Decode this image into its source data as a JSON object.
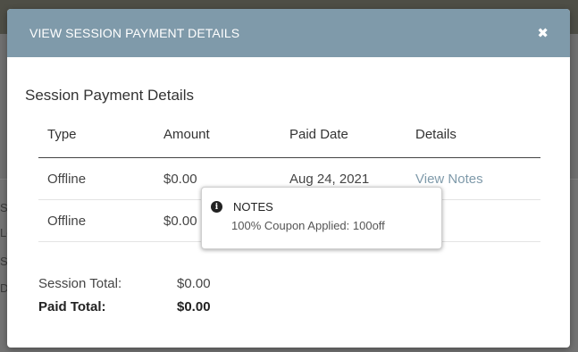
{
  "background": {
    "fragments": [
      "Si",
      "Lo",
      "Sp",
      "De"
    ]
  },
  "modal": {
    "title": "VIEW SESSION PAYMENT DETAILS",
    "close_glyph": "✖",
    "section_title": "Session Payment Details",
    "table": {
      "headers": [
        "Type",
        "Amount",
        "Paid Date",
        "Details"
      ],
      "rows": [
        {
          "type": "Offline",
          "amount": "$0.00",
          "paid_date": "Aug 24, 2021",
          "details_link": "View Notes"
        },
        {
          "type": "Offline",
          "amount": "$0.00",
          "paid_date": "",
          "details_link": ""
        }
      ]
    },
    "totals": {
      "session_total_label": "Session Total:",
      "session_total_value": "$0.00",
      "paid_total_label": "Paid Total:",
      "paid_total_value": "$0.00"
    }
  },
  "tooltip": {
    "icon": "info-icon",
    "title": "NOTES",
    "body": "100% Coupon Applied: 100off"
  },
  "colors": {
    "header_bg": "#7f9aaa",
    "link": "#7f9aaa",
    "overlay": "#707070"
  }
}
